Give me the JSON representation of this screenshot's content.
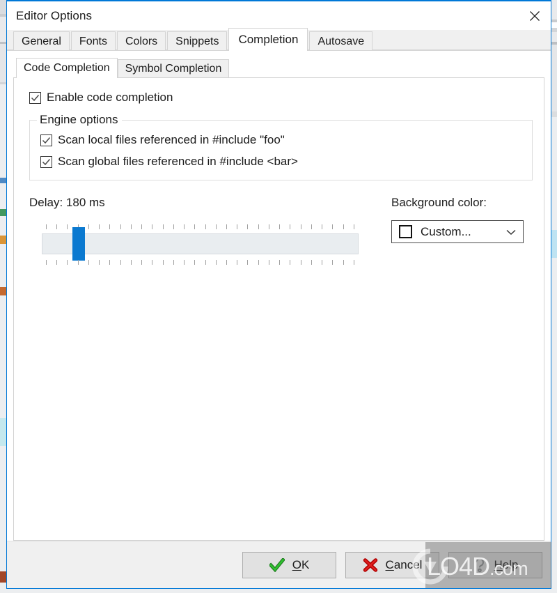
{
  "window": {
    "title": "Editor Options",
    "close_icon": "close-icon",
    "accent_color": "#0078d7"
  },
  "outer_tabs": [
    {
      "label": "General",
      "active": false
    },
    {
      "label": "Fonts",
      "active": false
    },
    {
      "label": "Colors",
      "active": false
    },
    {
      "label": "Snippets",
      "active": false
    },
    {
      "label": "Completion",
      "active": true
    },
    {
      "label": "Autosave",
      "active": false
    }
  ],
  "inner_tabs": [
    {
      "label": "Code Completion",
      "active": true
    },
    {
      "label": "Symbol Completion",
      "active": false
    }
  ],
  "code_completion": {
    "enable_checkbox": {
      "label": "Enable code completion",
      "checked": true
    },
    "engine_group": {
      "title": "Engine options",
      "options": [
        {
          "label": "Scan local files referenced in #include \"foo\"",
          "checked": true
        },
        {
          "label": "Scan global files referenced in #include <bar>",
          "checked": true
        }
      ]
    },
    "delay": {
      "label": "Delay: 180 ms",
      "value": 180,
      "unit": "ms",
      "tick_count": 30,
      "thumb_color": "#0b79d0",
      "thumb_position_percent": 10
    },
    "background_color": {
      "label": "Background color:",
      "selected": "Custom...",
      "swatch_color": "#ffffff",
      "arrow_icon": "chevron-down-icon"
    }
  },
  "footer": {
    "ok": {
      "label": "OK",
      "accesskey": "O",
      "icon": "check-icon"
    },
    "cancel": {
      "label": "Cancel",
      "accesskey": "C",
      "icon": "cross-icon"
    },
    "help": {
      "label": "Help",
      "accesskey": "H",
      "icon": "help-icon"
    }
  },
  "watermark": {
    "text": "LO4D",
    "suffix": ".com"
  }
}
